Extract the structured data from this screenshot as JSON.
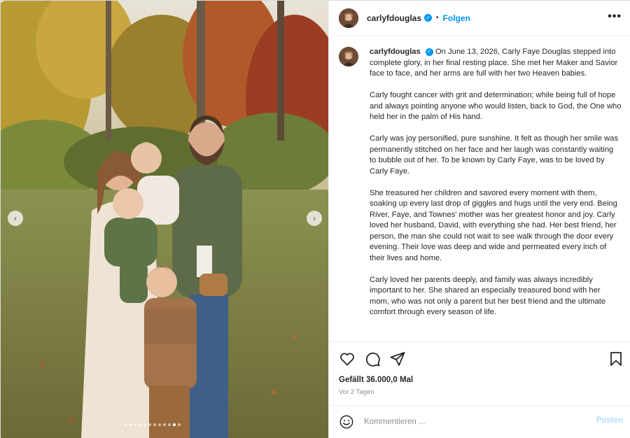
{
  "post": {
    "username": "carlyfdouglas",
    "follow_label": "Folgen",
    "separator": "•",
    "more_glyph": "•••",
    "verified_glyph": "✓",
    "caption_paragraphs": [
      "On June 13, 2026, Carly Faye Douglas stepped into complete glory, in her final resting place. She met her Maker and Savior face to face, and her arms are full with her two Heaven babies.",
      "Carly fought cancer with grit and determination; while being full of hope and always pointing anyone who would listen, back to God, the One who held her in the palm of His hand.",
      "Carly was joy personified, pure sunshine. It felt as though her smile was permanently stitched on her face and her laugh was constantly waiting to bubble out of her. To be known by Carly Faye, was to be loved by Carly Faye.",
      "She treasured her children and savored every moment with them, soaking up every last drop of giggles and hugs until the very end. Being River, Faye, and Townes' mother was her greatest honor and joy. Carly loved her husband, David, with everything she had. Her best friend, her person, the man she could not wait to see walk through the door every evening. Their love was deep and wide and permeated every inch of their lives and home.",
      "Carly loved her parents deeply, and family was always incredibly important to her. She shared an especially treasured bond with her mom, who was not only a parent but her best friend and the ultimate comfort through every season of life."
    ],
    "likes": "Gefällt 36.000,0 Mal",
    "timestamp": "Vor 2 Tagen",
    "comment_placeholder": "Kommentieren ...",
    "post_label": "Posten"
  },
  "media": {
    "prev_glyph": "‹",
    "next_glyph": "›",
    "carousel_dot_count": 12,
    "active_dot_index": 10
  },
  "icons": {
    "like": "heart-icon",
    "comment": "comment-icon",
    "share": "share-icon",
    "save": "bookmark-icon",
    "emoji": "emoji-icon"
  },
  "colors": {
    "accent": "#0095f6",
    "post_disabled": "#b2dffc",
    "muted": "#8e8e8e"
  }
}
